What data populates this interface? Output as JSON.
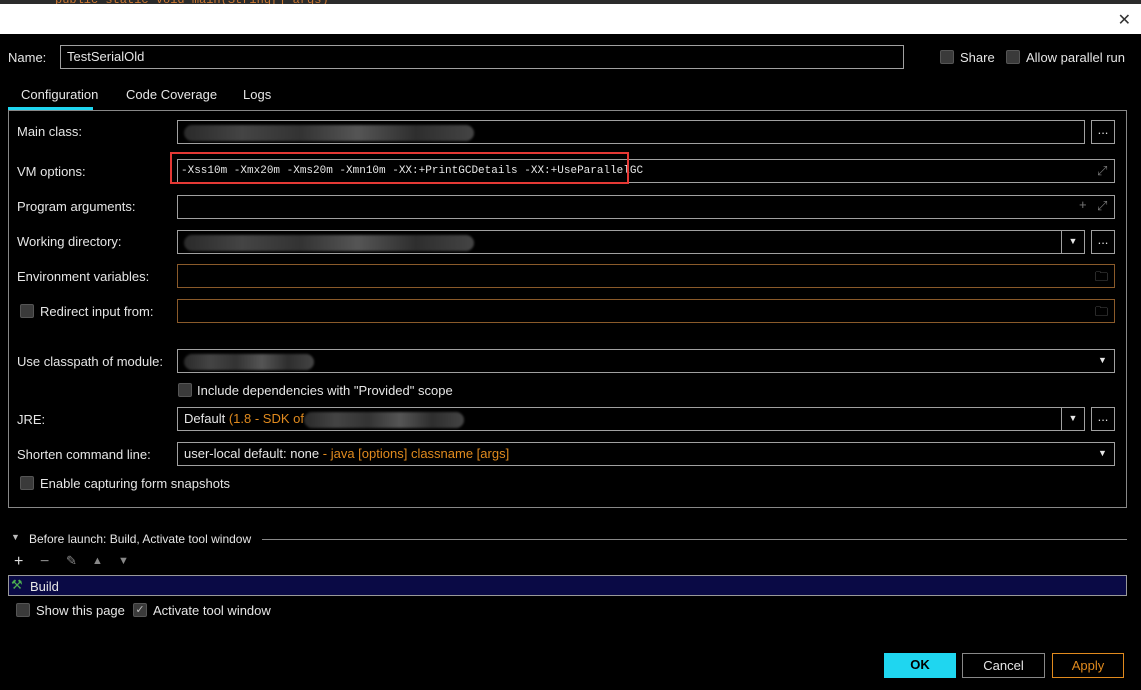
{
  "background_code": "public static void main(String[] args)",
  "name": {
    "label": "Name:",
    "value": "TestSerialOld"
  },
  "share": {
    "label": "Share",
    "checked": false
  },
  "parallel": {
    "label": "Allow parallel run",
    "checked": false
  },
  "tabs": [
    {
      "label": "Configuration",
      "active": true
    },
    {
      "label": "Code Coverage"
    },
    {
      "label": "Logs"
    }
  ],
  "form": {
    "main_class": {
      "label": "Main class:"
    },
    "vm_options": {
      "label": "VM options:",
      "value": "-Xss10m -Xmx20m -Xms20m -Xmn10m -XX:+PrintGCDetails -XX:+UseParallelGC"
    },
    "program_args": {
      "label": "Program arguments:"
    },
    "working_dir": {
      "label": "Working directory:"
    },
    "env_vars": {
      "label": "Environment variables:"
    },
    "redirect": {
      "label": "Redirect input from:",
      "checked": false
    },
    "classpath": {
      "label": "Use classpath of module:"
    },
    "include_deps": {
      "label": "Include dependencies with \"Provided\" scope",
      "checked": false
    },
    "jre": {
      "label": "JRE:",
      "value": "Default",
      "detail": "(1.8 - SDK of"
    },
    "shorten": {
      "label": "Shorten command line:",
      "value": "user-local default: none",
      "detail": "- java [options] classname [args]"
    },
    "snapshots": {
      "label": "Enable capturing form snapshots",
      "checked": false
    },
    "browse": "..."
  },
  "before_launch": {
    "title": "Before launch: Build, Activate tool window",
    "items": [
      "Build"
    ],
    "show_page": {
      "label": "Show this page",
      "checked": false
    },
    "activate": {
      "label": "Activate tool window",
      "checked": true
    }
  },
  "buttons": {
    "ok": "OK",
    "cancel": "Cancel",
    "apply": "Apply"
  },
  "colors": {
    "accent": "#1fd6f0",
    "highlight": "#e53935",
    "orange": "#e08a1e"
  }
}
